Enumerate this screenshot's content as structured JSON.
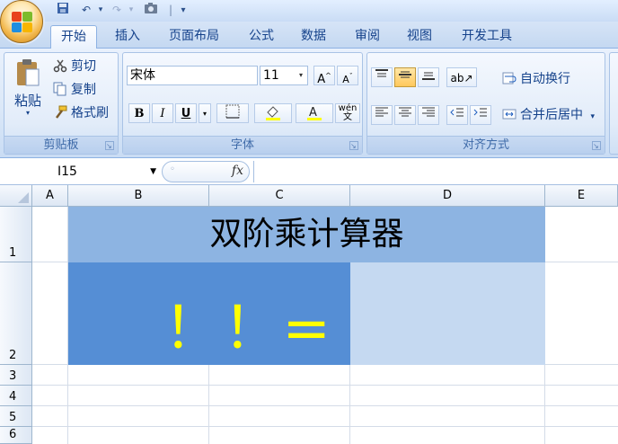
{
  "ribbon_tabs": [
    "开始",
    "插入",
    "页面布局",
    "公式",
    "数据",
    "审阅",
    "视图",
    "开发工具"
  ],
  "clipboard": {
    "paste_label": "粘贴",
    "cut_label": "剪切",
    "copy_label": "复制",
    "format_painter_label": "格式刷",
    "group_label": "剪贴板"
  },
  "font": {
    "font_name": "宋体",
    "font_size": "11",
    "bold": "B",
    "italic": "I",
    "underline": "U",
    "phonetic": "wén\n文",
    "group_label": "字体"
  },
  "alignment": {
    "wrap_label": "自动换行",
    "merge_label": "合并后居中",
    "group_label": "对齐方式"
  },
  "formula_bar": {
    "name_box": "I15",
    "fx": "fx",
    "value": ""
  },
  "sheet": {
    "columns": [
      "A",
      "B",
      "C",
      "D",
      "E"
    ],
    "rows": [
      "1",
      "2",
      "3",
      "4",
      "5",
      "6"
    ],
    "title_cell": "双阶乘计算器",
    "formula_cell": "！！=",
    "result_cell": ""
  },
  "colors": {
    "title_fill": "#8db4e2",
    "formula_fill": "#558ed5",
    "result_fill": "#c5d9f1",
    "formula_text": "#ffff00"
  }
}
